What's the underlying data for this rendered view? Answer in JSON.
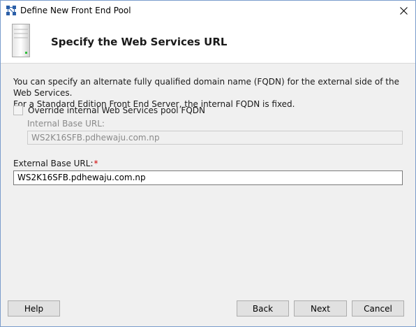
{
  "window": {
    "title": "Define New Front End Pool",
    "close_glyph": "✕"
  },
  "header": {
    "title": "Specify the Web Services URL",
    "icon": "server-icon"
  },
  "description": {
    "line1": "You can specify an alternate fully qualified domain name (FQDN) for the external side of the Web Services.",
    "line2": "For a Standard Edition Front End Server, the internal FQDN is fixed."
  },
  "override_checkbox": {
    "label": "Override internal Web Services pool FQDN",
    "checked": false,
    "enabled": true
  },
  "internal_url": {
    "label": "Internal Base URL:",
    "value": "WS2K16SFB.pdhewaju.com.np",
    "enabled": false
  },
  "external_url": {
    "label": "External Base URL:",
    "required_marker": "*",
    "value": "WS2K16SFB.pdhewaju.com.np"
  },
  "buttons": {
    "help": "Help",
    "back": "Back",
    "next": "Next",
    "cancel": "Cancel"
  },
  "colors": {
    "required": "#d00000",
    "window_border": "#7a9ccc",
    "app_icon": "#2b5fa8"
  }
}
